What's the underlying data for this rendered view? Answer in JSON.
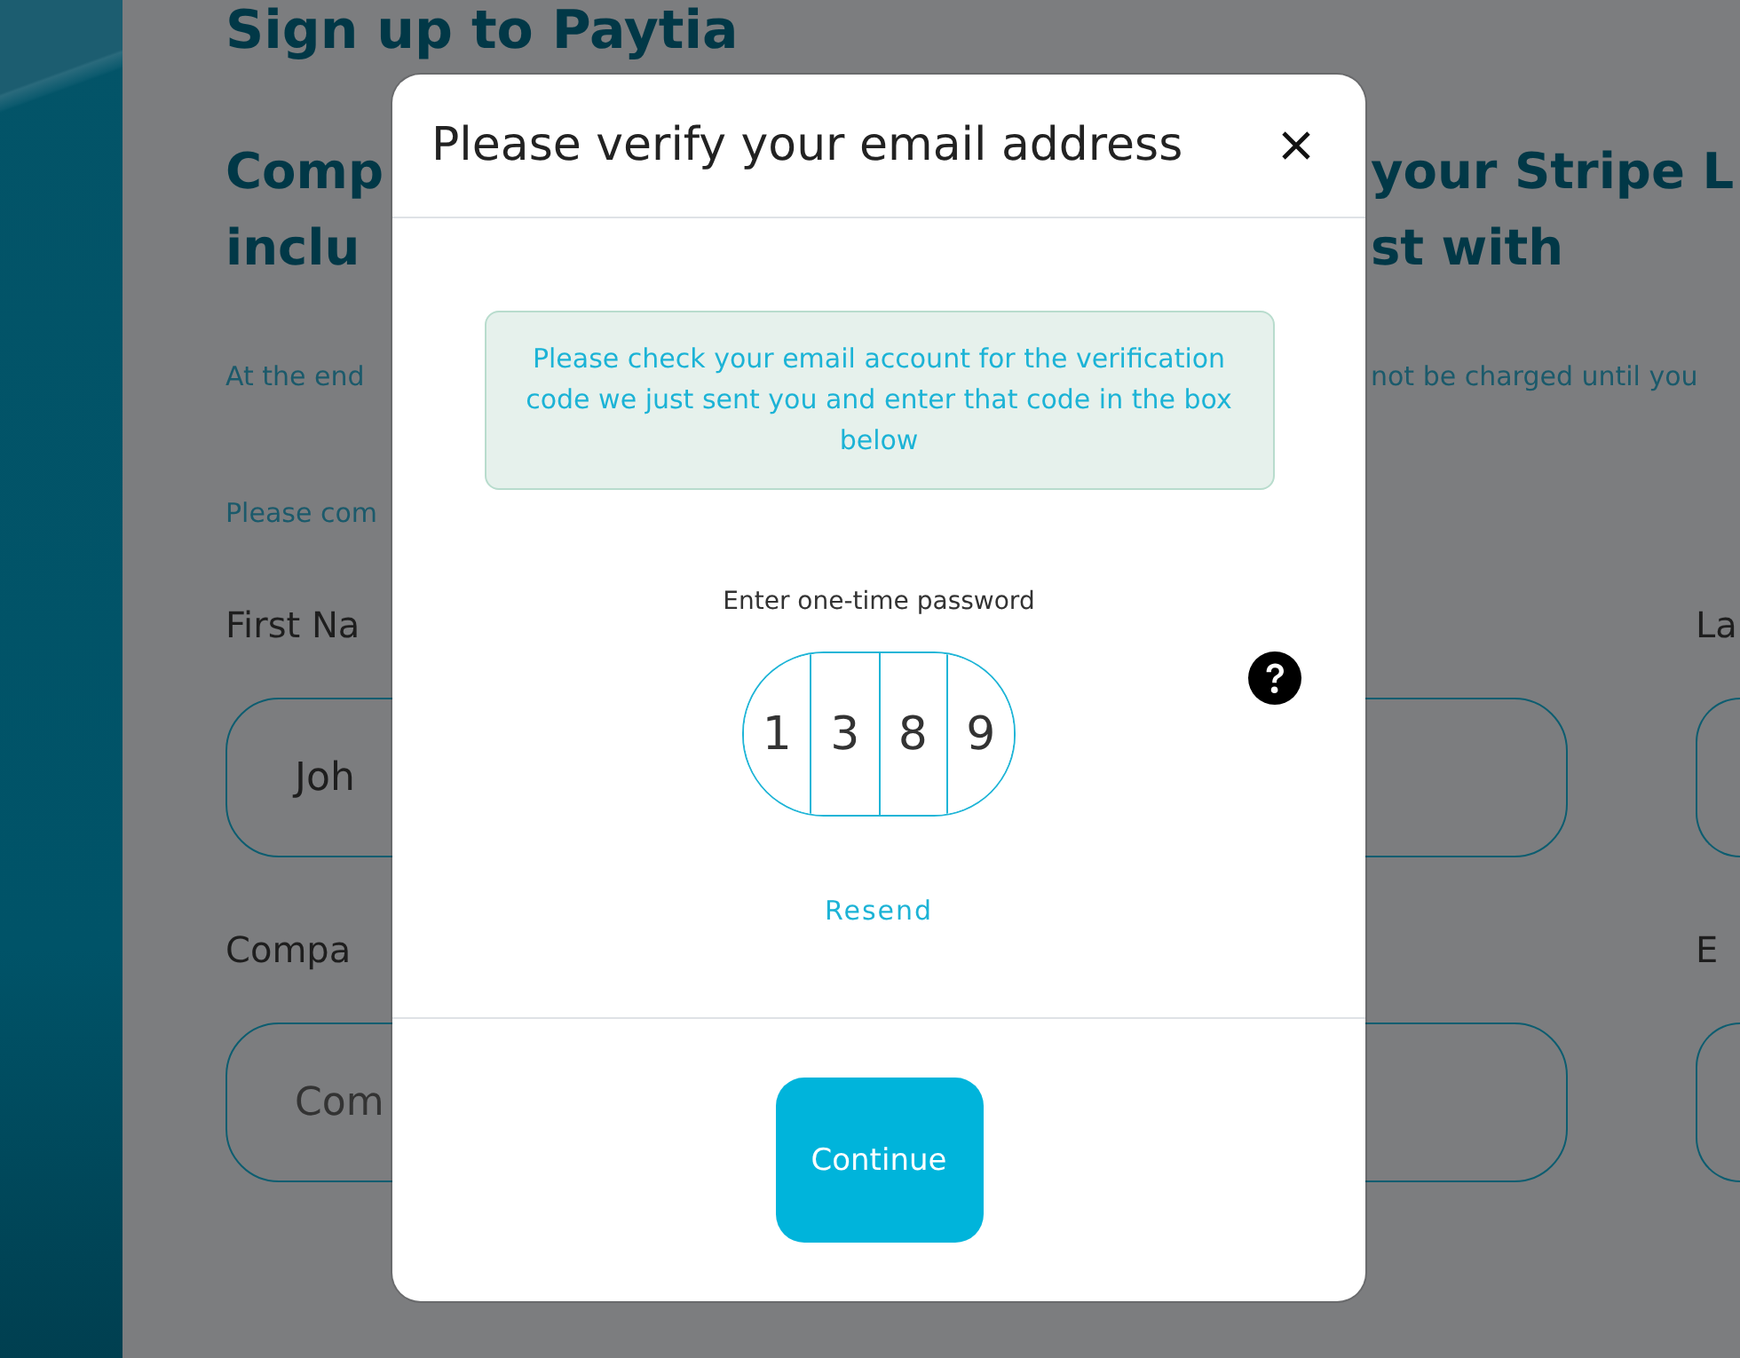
{
  "background": {
    "heading": "Sign up to Paytia",
    "intro_lines": [
      {
        "left": "Comp",
        "right": "your Stripe L"
      },
      {
        "left": "inclu",
        "right": "st with"
      }
    ],
    "paragraphs": [
      {
        "left": "At the end",
        "right": "not be charged until you"
      },
      {
        "left": "Please com"
      }
    ],
    "field_rows": [
      {
        "left": {
          "label": "First Na",
          "value": "Joh"
        },
        "right": {
          "label": "La"
        }
      },
      {
        "left": {
          "label": "Compa",
          "placeholder": "Com"
        },
        "right": {
          "label": "E"
        }
      }
    ]
  },
  "dialog": {
    "title": "Please verify your email address",
    "message": "Please check your email account for the verification code we just sent you and enter that code in the box below",
    "otp": {
      "label": "Enter one-time password",
      "digits": [
        "1",
        "3",
        "8",
        "9"
      ]
    },
    "resend": "Resend",
    "continue_button": "Continue"
  }
}
